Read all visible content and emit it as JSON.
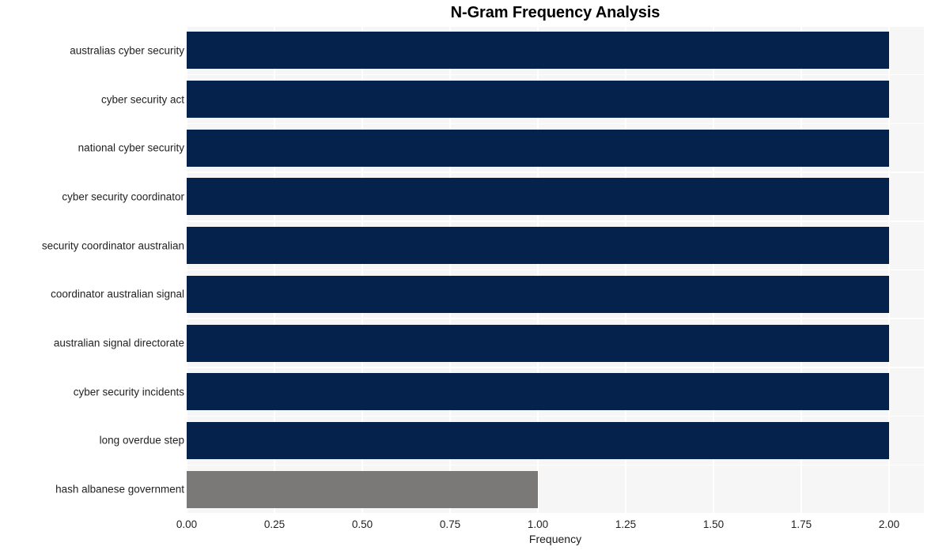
{
  "chart_data": {
    "type": "bar",
    "orientation": "horizontal",
    "title": "N-Gram Frequency Analysis",
    "xlabel": "Frequency",
    "ylabel": "",
    "categories": [
      "australias cyber security",
      "cyber security act",
      "national cyber security",
      "cyber security coordinator",
      "security coordinator australian",
      "coordinator australian signal",
      "australian signal directorate",
      "cyber security incidents",
      "long overdue step",
      "hash albanese government"
    ],
    "values": [
      2,
      2,
      2,
      2,
      2,
      2,
      2,
      2,
      2,
      1
    ],
    "bar_colors": [
      "#04224c",
      "#04224c",
      "#04224c",
      "#04224c",
      "#04224c",
      "#04224c",
      "#04224c",
      "#04224c",
      "#04224c",
      "#7a7978"
    ],
    "xlim": [
      0,
      2
    ],
    "xticks": [
      0,
      0.25,
      0.5,
      0.75,
      1,
      1.25,
      1.5,
      1.75,
      2
    ],
    "xtick_labels": [
      "0.00",
      "0.25",
      "0.50",
      "0.75",
      "1.00",
      "1.25",
      "1.50",
      "1.75",
      "2.00"
    ],
    "grid": true,
    "grid_color": "#ffffff",
    "plot_background": "#f6f6f6",
    "figure_background": "#ffffff",
    "legend": null
  }
}
